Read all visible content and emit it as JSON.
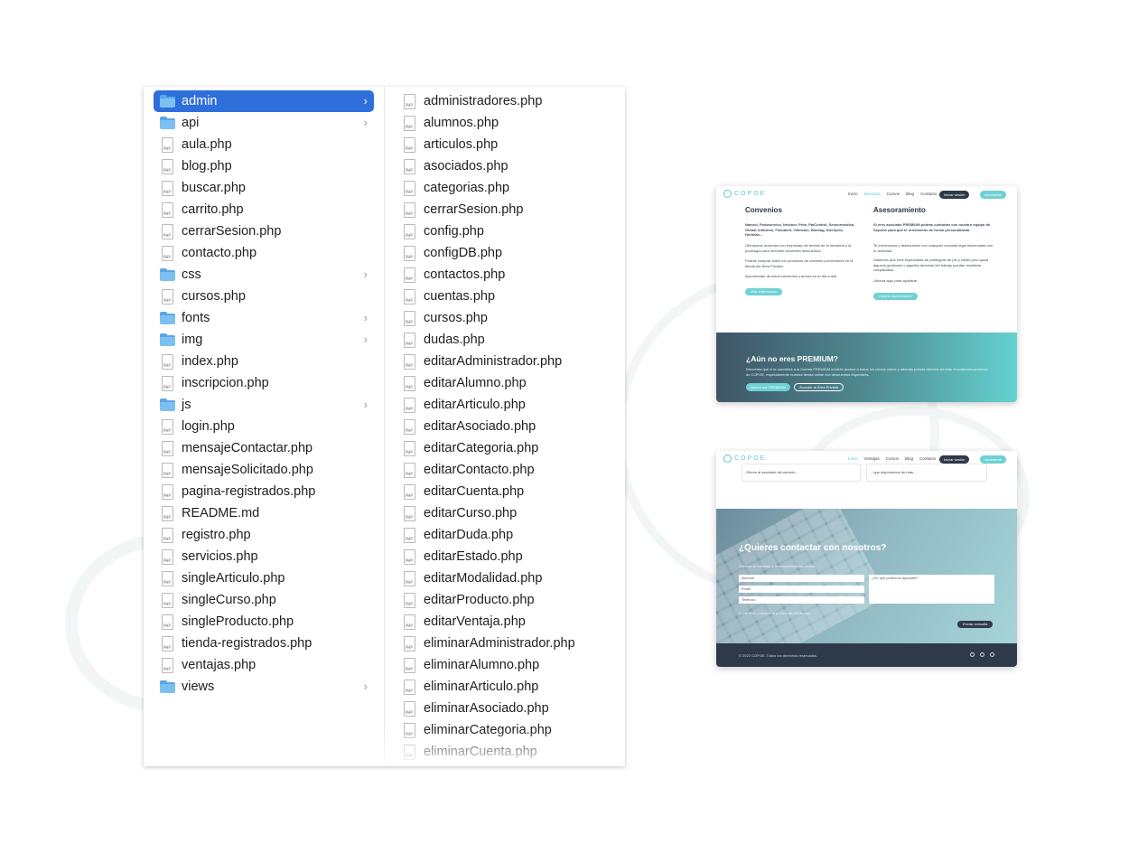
{
  "finder": {
    "column1": [
      {
        "name": "admin",
        "type": "folder",
        "selected": true,
        "has_children": true
      },
      {
        "name": "api",
        "type": "folder",
        "has_children": true
      },
      {
        "name": "aula.php",
        "type": "file"
      },
      {
        "name": "blog.php",
        "type": "file"
      },
      {
        "name": "buscar.php",
        "type": "file"
      },
      {
        "name": "carrito.php",
        "type": "file"
      },
      {
        "name": "cerrarSesion.php",
        "type": "file"
      },
      {
        "name": "contacto.php",
        "type": "file"
      },
      {
        "name": "css",
        "type": "folder",
        "has_children": true
      },
      {
        "name": "cursos.php",
        "type": "file"
      },
      {
        "name": "fonts",
        "type": "folder",
        "has_children": true
      },
      {
        "name": "img",
        "type": "folder",
        "has_children": true
      },
      {
        "name": "index.php",
        "type": "file"
      },
      {
        "name": "inscripcion.php",
        "type": "file"
      },
      {
        "name": "js",
        "type": "folder",
        "has_children": true
      },
      {
        "name": "login.php",
        "type": "file"
      },
      {
        "name": "mensajeContactar.php",
        "type": "file"
      },
      {
        "name": "mensajeSolicitado.php",
        "type": "file"
      },
      {
        "name": "pagina-registrados.php",
        "type": "file"
      },
      {
        "name": "README.md",
        "type": "file"
      },
      {
        "name": "registro.php",
        "type": "file"
      },
      {
        "name": "servicios.php",
        "type": "file"
      },
      {
        "name": "singleArticulo.php",
        "type": "file"
      },
      {
        "name": "singleCurso.php",
        "type": "file"
      },
      {
        "name": "singleProducto.php",
        "type": "file"
      },
      {
        "name": "tienda-registrados.php",
        "type": "file"
      },
      {
        "name": "ventajas.php",
        "type": "file"
      },
      {
        "name": "views",
        "type": "folder",
        "has_children": true
      }
    ],
    "column2": [
      {
        "name": "administradores.php",
        "type": "file"
      },
      {
        "name": "alumnos.php",
        "type": "file"
      },
      {
        "name": "articulos.php",
        "type": "file"
      },
      {
        "name": "asociados.php",
        "type": "file"
      },
      {
        "name": "categorias.php",
        "type": "file"
      },
      {
        "name": "cerrarSesion.php",
        "type": "file"
      },
      {
        "name": "config.php",
        "type": "file"
      },
      {
        "name": "configDB.php",
        "type": "file"
      },
      {
        "name": "contactos.php",
        "type": "file"
      },
      {
        "name": "cuentas.php",
        "type": "file"
      },
      {
        "name": "cursos.php",
        "type": "file"
      },
      {
        "name": "dudas.php",
        "type": "file"
      },
      {
        "name": "editarAdministrador.php",
        "type": "file"
      },
      {
        "name": "editarAlumno.php",
        "type": "file"
      },
      {
        "name": "editarArticulo.php",
        "type": "file"
      },
      {
        "name": "editarAsociado.php",
        "type": "file"
      },
      {
        "name": "editarCategoria.php",
        "type": "file"
      },
      {
        "name": "editarContacto.php",
        "type": "file"
      },
      {
        "name": "editarCuenta.php",
        "type": "file"
      },
      {
        "name": "editarCurso.php",
        "type": "file"
      },
      {
        "name": "editarDuda.php",
        "type": "file"
      },
      {
        "name": "editarEstado.php",
        "type": "file"
      },
      {
        "name": "editarModalidad.php",
        "type": "file"
      },
      {
        "name": "editarProducto.php",
        "type": "file"
      },
      {
        "name": "editarVentaja.php",
        "type": "file"
      },
      {
        "name": "eliminarAdministrador.php",
        "type": "file"
      },
      {
        "name": "eliminarAlumno.php",
        "type": "file"
      },
      {
        "name": "eliminarArticulo.php",
        "type": "file"
      },
      {
        "name": "eliminarAsociado.php",
        "type": "file"
      },
      {
        "name": "eliminarCategoria.php",
        "type": "file"
      },
      {
        "name": "eliminarCuenta.php",
        "type": "file"
      }
    ]
  },
  "preview1": {
    "logo": "COPOE",
    "nav": [
      "Inicio",
      "Servicios",
      "Cursos",
      "Blog",
      "Contacto"
    ],
    "nav_active": 1,
    "btn_login": "Iniciar sesión",
    "btn_join": "Asociarme",
    "left_title": "Convenios",
    "left_bold": "Namrol, Podoservice, Nextoor, Prim, PaiControl, Sensormedica, Global Uniforms, Fisiobiert, Ofimedic, Biomag, Sterilycia, Herbitas...",
    "left_p1": "Ofrecemos acuerdos con empresas del ámbito de la medicina y la podología para ofrecerte increíbles descuentos.",
    "left_p2": "Podrás comprar todos los productos de nuestros proveedores en la tienda del Área Privada.",
    "left_p3": "Aprovéchate de estos convenios y ahorra en tu día a día!",
    "left_btn": "Más información",
    "right_title": "Asesoramiento",
    "right_bold": "Si eres asociado PREMIUM podrás contactar con nuestro equipo de Soporte para que te orientemos de forma personalizada.",
    "right_p1": "Te informamos y asesoramos con cualquier consulta legal relacionada con tu actividad.",
    "right_p2": "Sabemos que eres especialista de patologías de pie y tobillo pero quizá algunos gestiones o papeles derivado del trabajo puedan resultarte complicados.",
    "right_p3": "¡Ahorra aquí para ayudarte.",
    "right_btn": "¡Quiero asesorarme!",
    "banner_title": "¿Aún no eres PREMIUM?",
    "banner_text": "Recuerda que si te suscribes a la Cuenta PREMIUM tendrás acceso a todos los cursos online y además podrás disfrutar de todo el contenido premium de COPOE, especialmente nuestra tienda online con descuentos especiales.",
    "banner_btn1": "Quiero ser PREMIUM",
    "banner_btn2": "Acceder al Área Privada"
  },
  "preview2": {
    "logo": "COPOE",
    "nav": [
      "Inicio",
      "Ventajas",
      "Cursos",
      "Blog",
      "Contacto"
    ],
    "nav_active": 0,
    "btn_login": "Iniciar sesión",
    "btn_join": "Asociarme",
    "card_left": "Ofrece al asociado del servicio...",
    "card_right": "...que disponemos de más...",
    "contact_title": "¿Quieres contactar con nosotros?",
    "contact_sub": "Déjanos tu mensaje y te responderemos pronto.",
    "field_name": "Nombre",
    "field_email": "Email",
    "field_phone": "Teléfono",
    "field_message": "¿En qué podemos ayudarte?",
    "checkbox_label": "He leído y acepto la política de privacidad",
    "send_btn": "Enviar consulta",
    "footer_text": "© 2022 COPOE. Todos los derechos reservados.",
    "social": [
      "facebook-icon",
      "instagram-icon",
      "twitter-icon"
    ]
  }
}
